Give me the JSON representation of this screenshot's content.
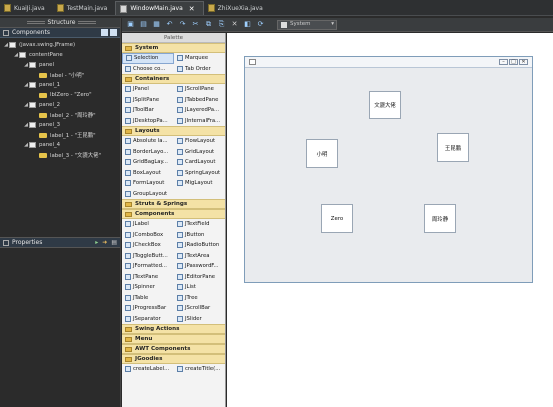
{
  "tabs": [
    {
      "label": "KuaiJi.java",
      "active": false
    },
    {
      "label": "TestMain.java",
      "active": false
    },
    {
      "label": "WindowMain.java",
      "active": true
    },
    {
      "label": "ZhiXueXia.java",
      "active": false
    }
  ],
  "structure": {
    "title": "Structure",
    "components_title": "Components",
    "tree": [
      {
        "label": "(javax.swing.JFrame)",
        "level": 0,
        "expanded": true,
        "kind": "node"
      },
      {
        "label": "contentPane",
        "level": 1,
        "expanded": true,
        "kind": "node"
      },
      {
        "label": "panel",
        "level": 2,
        "expanded": true,
        "kind": "node"
      },
      {
        "label": "label - \"小明\"",
        "level": 3,
        "expanded": null,
        "kind": "label"
      },
      {
        "label": "panel_1",
        "level": 2,
        "expanded": true,
        "kind": "node"
      },
      {
        "label": "lblZero - \"Zero\"",
        "level": 3,
        "expanded": null,
        "kind": "label"
      },
      {
        "label": "panel_2",
        "level": 2,
        "expanded": true,
        "kind": "node"
      },
      {
        "label": "label_2 - \"周玲静\"",
        "level": 3,
        "expanded": null,
        "kind": "label"
      },
      {
        "label": "panel_3",
        "level": 2,
        "expanded": true,
        "kind": "node"
      },
      {
        "label": "label_1 - \"王昆鹏\"",
        "level": 3,
        "expanded": null,
        "kind": "label"
      },
      {
        "label": "panel_4",
        "level": 2,
        "expanded": true,
        "kind": "node"
      },
      {
        "label": "label_3 - \"文骁大佬\"",
        "level": 3,
        "expanded": null,
        "kind": "label"
      }
    ]
  },
  "properties": {
    "title": "Properties"
  },
  "toolbar": {
    "selector_text": "System"
  },
  "palette": {
    "title": "Palette",
    "sections": [
      {
        "name": "System",
        "items": [
          "Selection",
          "Marquee",
          "Choose co...",
          "Tab Order"
        ],
        "selected": "Selection"
      },
      {
        "name": "Containers",
        "items": [
          "JPanel",
          "JScrollPane",
          "JSplitPane",
          "JTabbedPane",
          "JToolBar",
          "JLayeredPa...",
          "JDesktopPa...",
          "JInternalFra..."
        ]
      },
      {
        "name": "Layouts",
        "items": [
          "Absolute la...",
          "FlowLayout",
          "BorderLayo...",
          "GridLayout",
          "GridBagLay...",
          "CardLayout",
          "BoxLayout",
          "SpringLayout",
          "FormLayout",
          "MigLayout",
          "GroupLayout"
        ]
      },
      {
        "name": "Struts & Springs",
        "items": []
      },
      {
        "name": "Components",
        "items": [
          "JLabel",
          "JTextField",
          "JComboBox",
          "JButton",
          "JCheckBox",
          "JRadioButton",
          "JToggleButt...",
          "JTextArea",
          "JFormatted...",
          "JPasswordF...",
          "JTextPane",
          "JEditorPane",
          "JSpinner",
          "JList",
          "JTable",
          "JTree",
          "JProgressBar",
          "JScrollBar",
          "JSeparator",
          "JSlider"
        ]
      },
      {
        "name": "Swing Actions",
        "items": []
      },
      {
        "name": "Menu",
        "items": []
      },
      {
        "name": "AWT Components",
        "items": []
      },
      {
        "name": "JGoodies",
        "items": [
          "createLabel...",
          "createTitle(..."
        ]
      }
    ]
  },
  "canvas": {
    "labels": {
      "xiaoming": "小明",
      "zero": "Zero",
      "wenxiao": "文骁大佬",
      "wangkunpeng": "王昆鹏",
      "zhoulingjing": "周玲静"
    }
  }
}
